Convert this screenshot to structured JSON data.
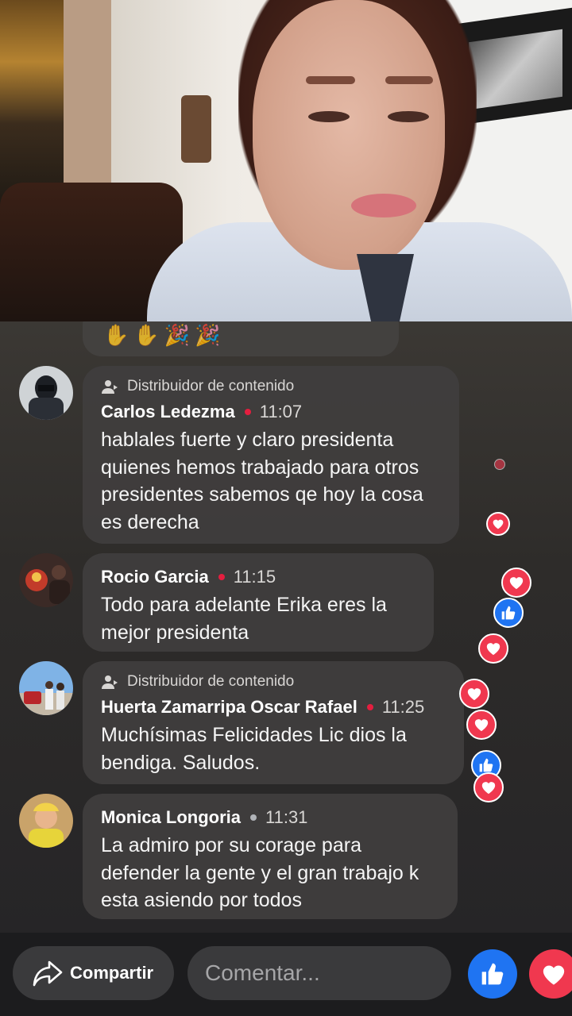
{
  "live_video": {
    "description_icon": "video-frame"
  },
  "comments": [
    {
      "role": "Distribuidor de contenido",
      "author": "Carlos Ledezma",
      "time": "11:07",
      "dot_color": "#e41e3f",
      "text": "hablales fuerte y claro presidenta quienes hemos trabajado para otros presidentes sabemos qe hoy la cosa es derecha"
    },
    {
      "role": "",
      "author": "Rocio Garcia",
      "time": "11:15",
      "dot_color": "#e41e3f",
      "text": "Todo para adelante Erika eres la mejor presidenta"
    },
    {
      "role": "Distribuidor de contenido",
      "author": "Huerta Zamarripa Oscar Rafael",
      "time": "11:25",
      "dot_color": "#e41e3f",
      "text": "Muchísimas Felicidades Lic dios la bendiga. Saludos."
    },
    {
      "role": "",
      "author": "Monica Longoria",
      "time": "11:31",
      "dot_color": "#b0b3b8",
      "text": "La admiro por su corage para defender la gente y el gran trabajo k esta asiendo por todos"
    }
  ],
  "bottom_bar": {
    "share_label": "Compartir",
    "comment_placeholder": "Comentar..."
  },
  "colors": {
    "like_blue": "#1f74f2",
    "love_red": "#f0384f"
  }
}
